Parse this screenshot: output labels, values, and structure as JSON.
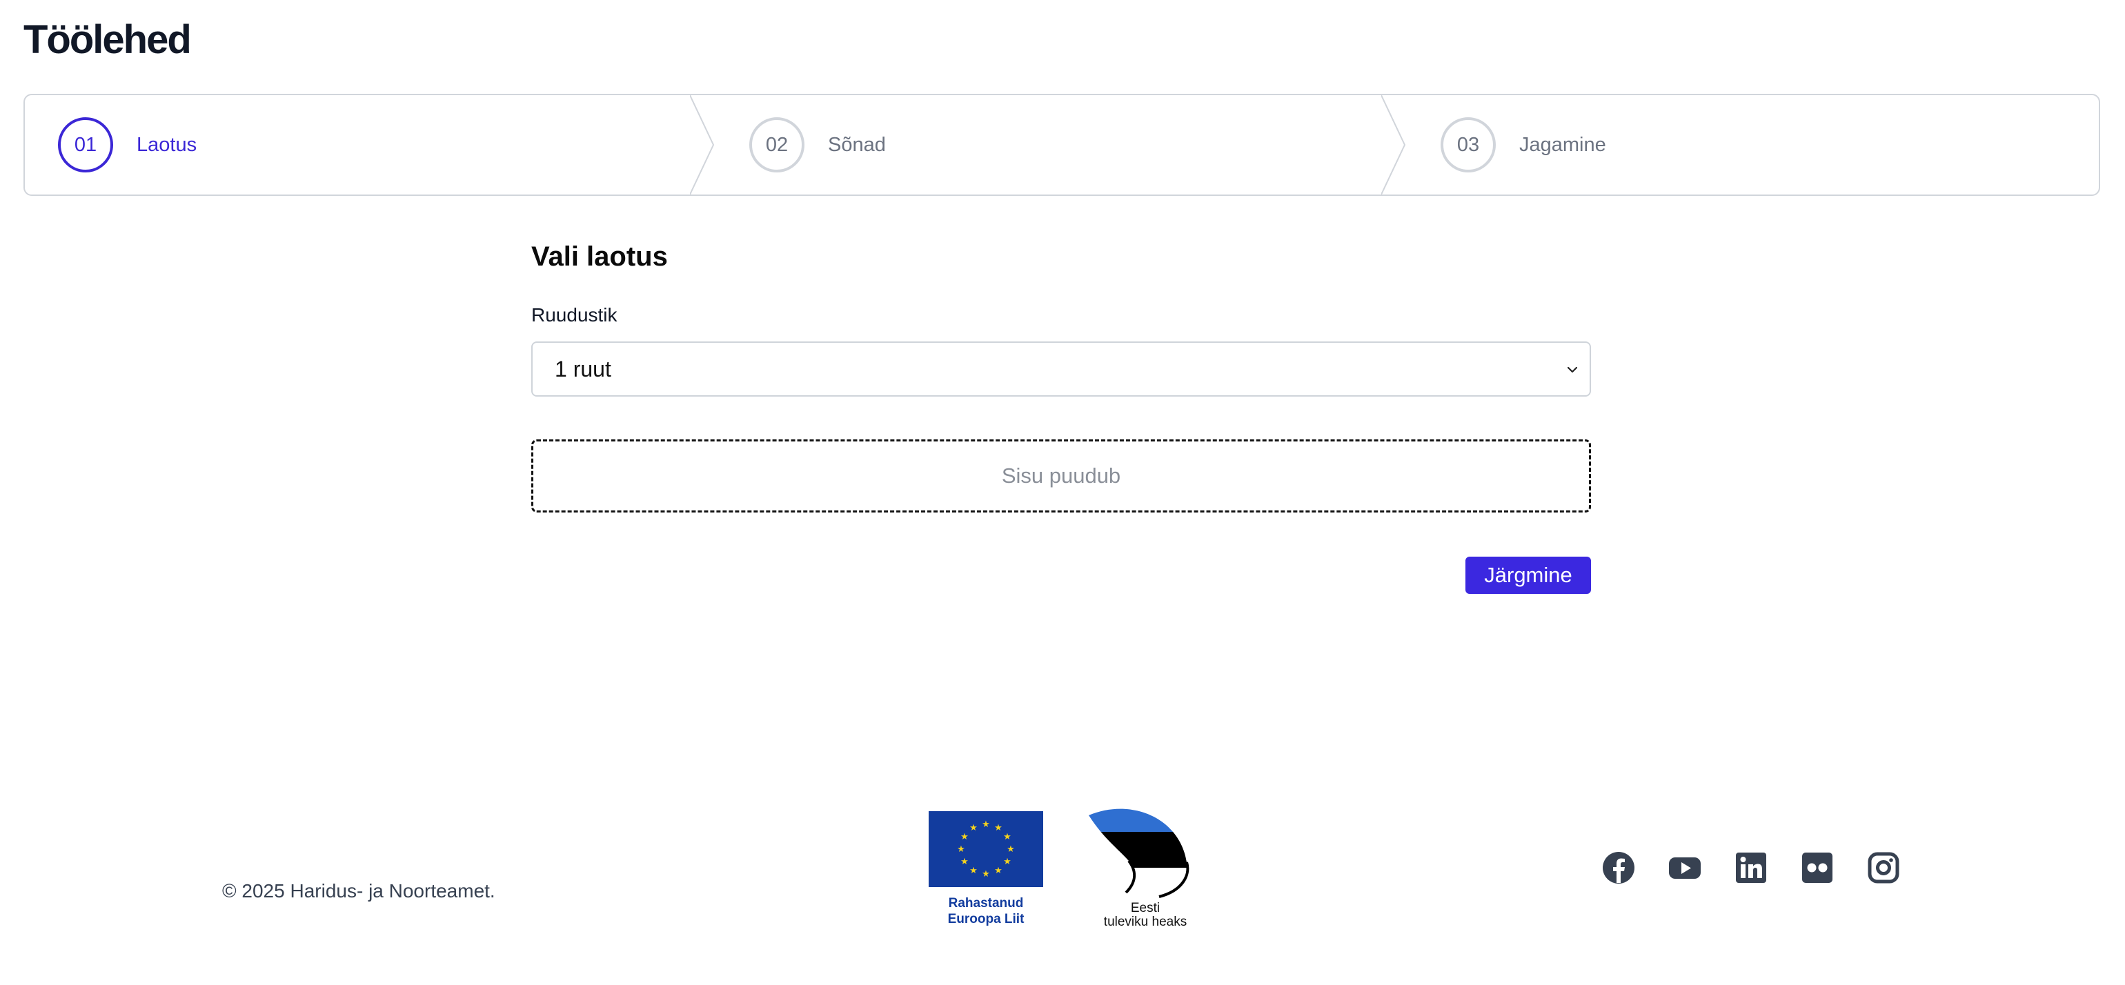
{
  "page": {
    "title": "Töölehed"
  },
  "stepper": {
    "steps": [
      {
        "number": "01",
        "label": "Laotus",
        "active": true
      },
      {
        "number": "02",
        "label": "Sõnad",
        "active": false
      },
      {
        "number": "03",
        "label": "Jagamine",
        "active": false
      }
    ]
  },
  "form": {
    "section_title": "Vali laotus",
    "grid_label": "Ruudustik",
    "grid_value": "1 ruut",
    "empty_text": "Sisu puudub",
    "next_label": "Järgmine"
  },
  "footer": {
    "copyright": "© 2025 Haridus- ja Noorteamet.",
    "eu_line1": "Rahastanud",
    "eu_line2": "Euroopa Liit",
    "ee_line1": "Eesti",
    "ee_line2": "tuleviku heaks",
    "socials": [
      "facebook-icon",
      "youtube-icon",
      "linkedin-icon",
      "flickr-icon",
      "instagram-icon"
    ]
  },
  "colors": {
    "accent": "#3b28e0",
    "eu_blue": "#123c9e",
    "icon_gray": "#374151"
  }
}
